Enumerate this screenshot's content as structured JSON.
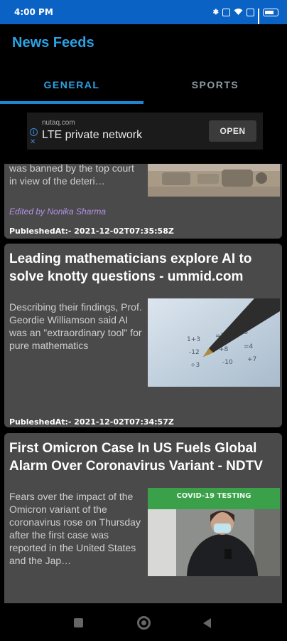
{
  "status_bar": {
    "time": "4:00 PM",
    "icons": [
      "bluetooth-icon",
      "vibrate-icon",
      "wifi-icon",
      "signal-icon",
      "battery-icon"
    ],
    "battery": "93"
  },
  "app": {
    "title": "News Feeds",
    "accent": "#29a3e6"
  },
  "tabs": [
    {
      "label": "GENERAL",
      "active": true
    },
    {
      "label": "SPORTS",
      "active": false
    }
  ],
  "ad": {
    "domain": "nutaq.com",
    "title": "LTE private network",
    "button": "OPEN"
  },
  "articles": [
    {
      "title": "",
      "description": "was banned by the top court in view of the deteri…",
      "editor": "Edited by Nonika Sharma",
      "published": "PubleshedAt:- 2021-12-02T07:35:58Z"
    },
    {
      "title": "Leading mathematicians explore AI to solve knotty questions - ummid.com",
      "description": "Describing their findings, Prof. Geordie Williamson said AI was an \"extraordinary tool\" for pure mathematics",
      "published": "PubleshedAt:- 2021-12-02T07:34:57Z"
    },
    {
      "title": "First Omicron Case In US Fuels Global Alarm Over Coronavirus Variant - NDTV",
      "description": "Fears over the impact of the Omicron variant of the coronavirus rose on Thursday after the first case was reported in the United States and the Jap…",
      "image_banner_text": "COVID-19 TESTING"
    }
  ],
  "nav": {
    "icons": [
      "recents-icon",
      "home-icon",
      "back-icon"
    ]
  }
}
